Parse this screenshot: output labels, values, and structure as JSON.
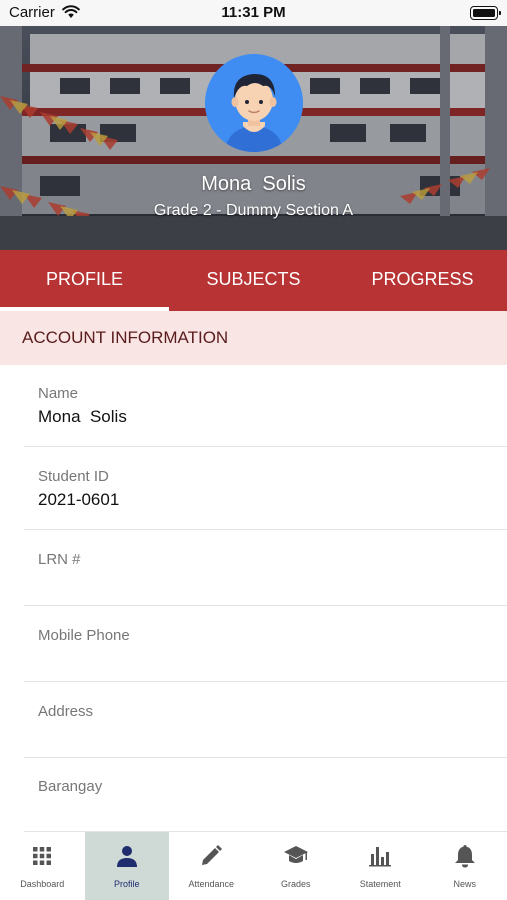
{
  "status_bar": {
    "carrier": "Carrier",
    "time": "11:31 PM"
  },
  "profile": {
    "name": "Mona  Solis",
    "grade_section": "Grade 2 - Dummy Section A"
  },
  "tabs": [
    {
      "label": "PROFILE",
      "active": true
    },
    {
      "label": "SUBJECTS",
      "active": false
    },
    {
      "label": "PROGRESS",
      "active": false
    }
  ],
  "section": {
    "title": "ACCOUNT INFORMATION"
  },
  "fields": [
    {
      "label": "Name",
      "value": "Mona  Solis"
    },
    {
      "label": "Student ID",
      "value": "2021-0601"
    },
    {
      "label": "LRN #",
      "value": ""
    },
    {
      "label": "Mobile Phone",
      "value": ""
    },
    {
      "label": "Address",
      "value": ""
    },
    {
      "label": "Barangay",
      "value": ""
    }
  ],
  "bottom_nav": [
    {
      "label": "Dashboard",
      "icon": "grid-icon",
      "active": false
    },
    {
      "label": "Profile",
      "icon": "person-icon",
      "active": true
    },
    {
      "label": "Attendance",
      "icon": "pencil-icon",
      "active": false
    },
    {
      "label": "Grades",
      "icon": "graduation-cap-icon",
      "active": false
    },
    {
      "label": "Statement",
      "icon": "bar-chart-icon",
      "active": false
    },
    {
      "label": "News",
      "icon": "bell-icon",
      "active": false
    }
  ],
  "colors": {
    "accent": "#b83334",
    "section_bg": "#f8e5e4",
    "active_nav_bg": "#cfd9d6",
    "nav_icon": "#555555",
    "nav_icon_active": "#1f2d6e"
  }
}
